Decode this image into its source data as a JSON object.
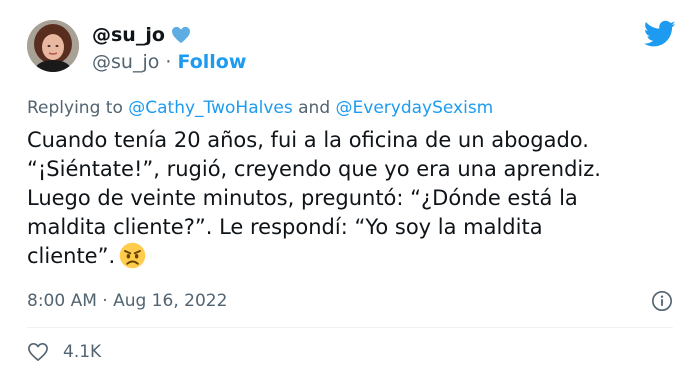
{
  "author": {
    "name": "@su_jo",
    "handle": "@su_jo",
    "separator": " · ",
    "follow_label": "Follow"
  },
  "reply": {
    "prefix": "Replying to ",
    "mention1": "@Cathy_TwoHalves",
    "joiner": " and ",
    "mention2": "@EverydaySexism"
  },
  "tweet": {
    "lines": [
      "Cuando tenía 20 años, fui a la oficina de un abogado.",
      "“¡Siéntate!”, rugió, creyendo que yo era una aprendiz.",
      "Luego de veinte minutos, preguntó: “¿Dónde está la",
      "maldita cliente?”. Le respondí: “Yo soy la maldita",
      "cliente”."
    ],
    "emoji": "angry-face-emoji"
  },
  "meta": {
    "timestamp": "8:00 AM · Aug 16, 2022"
  },
  "engagement": {
    "likes": "4.1K"
  },
  "icons": {
    "verified_heart": "blue-heart-icon",
    "brand": "twitter-bird-icon",
    "info": "info-icon",
    "like": "heart-outline-icon"
  },
  "colors": {
    "accent": "#1d9bf0",
    "text": "#0f1419",
    "muted": "#536471"
  }
}
